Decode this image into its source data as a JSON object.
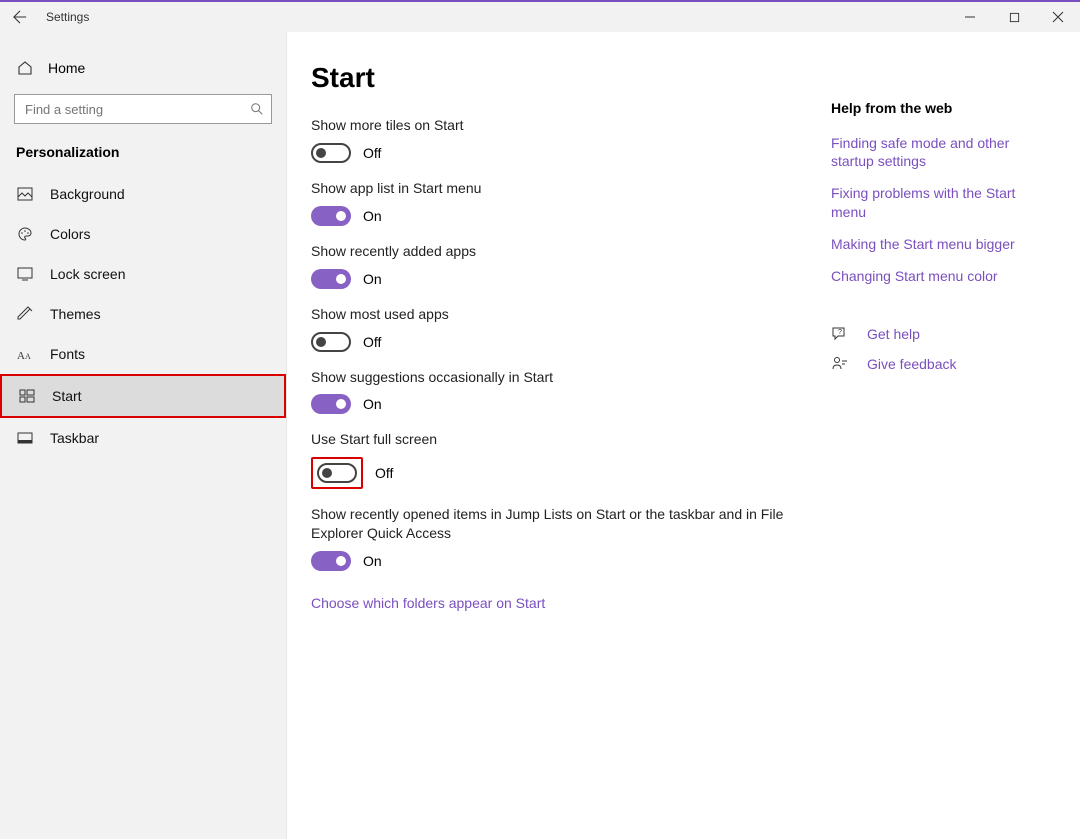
{
  "titlebar": {
    "title": "Settings"
  },
  "sidebar": {
    "home_label": "Home",
    "search_placeholder": "Find a setting",
    "category_title": "Personalization",
    "items": [
      {
        "label": "Background"
      },
      {
        "label": "Colors"
      },
      {
        "label": "Lock screen"
      },
      {
        "label": "Themes"
      },
      {
        "label": "Fonts"
      },
      {
        "label": "Start"
      },
      {
        "label": "Taskbar"
      }
    ]
  },
  "page": {
    "title": "Start",
    "settings": [
      {
        "label": "Show more tiles on Start",
        "on": false,
        "state": "Off"
      },
      {
        "label": "Show app list in Start menu",
        "on": true,
        "state": "On"
      },
      {
        "label": "Show recently added apps",
        "on": true,
        "state": "On"
      },
      {
        "label": "Show most used apps",
        "on": false,
        "state": "Off"
      },
      {
        "label": "Show suggestions occasionally in Start",
        "on": true,
        "state": "On"
      },
      {
        "label": "Use Start full screen",
        "on": false,
        "state": "Off",
        "highlight": true
      },
      {
        "label": "Show recently opened items in Jump Lists on Start or the taskbar and in File Explorer Quick Access",
        "on": true,
        "state": "On"
      }
    ],
    "folders_link": "Choose which folders appear on Start"
  },
  "aside": {
    "title": "Help from the web",
    "links": [
      "Finding safe mode and other startup settings",
      "Fixing problems with the Start menu",
      "Making the Start menu bigger",
      "Changing Start menu color"
    ],
    "get_help": "Get help",
    "give_feedback": "Give feedback"
  }
}
